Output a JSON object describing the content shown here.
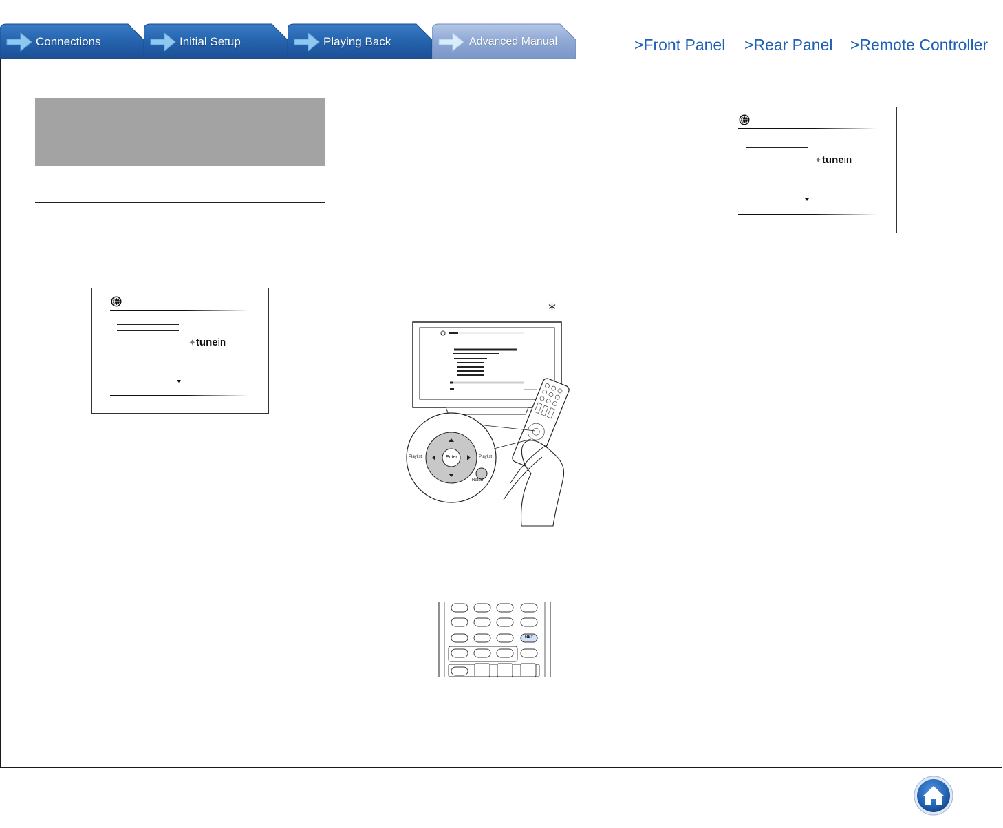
{
  "tabs": [
    {
      "label": "Connections",
      "active": false
    },
    {
      "label": "Initial Setup",
      "active": false
    },
    {
      "label": "Playing Back",
      "active": false
    },
    {
      "label": "Advanced Manual",
      "active": true
    }
  ],
  "nav_links": {
    "front_panel": ">Front Panel",
    "rear_panel": ">Rear Panel",
    "remote_controller": ">Remote Controller"
  },
  "screens": {
    "logo_bold": "tune",
    "logo_light": "in"
  },
  "illustration": {
    "footnote_mark": "*",
    "button_labels": {
      "enter": "Enter",
      "playlist_left": "Playlist",
      "playlist_right": "Playlist",
      "return": "Return",
      "net": "NET"
    }
  },
  "colors": {
    "tab_blue": "#2a67b2",
    "tab_active": "#8fa8d4",
    "link_blue": "#1f5fb4",
    "frame_right": "#d9534f",
    "gray_box": "#a3a3a3"
  },
  "icons": {
    "home": "home-icon",
    "globe": "globe-icon",
    "tab_arrow": "arrow-right-icon"
  }
}
